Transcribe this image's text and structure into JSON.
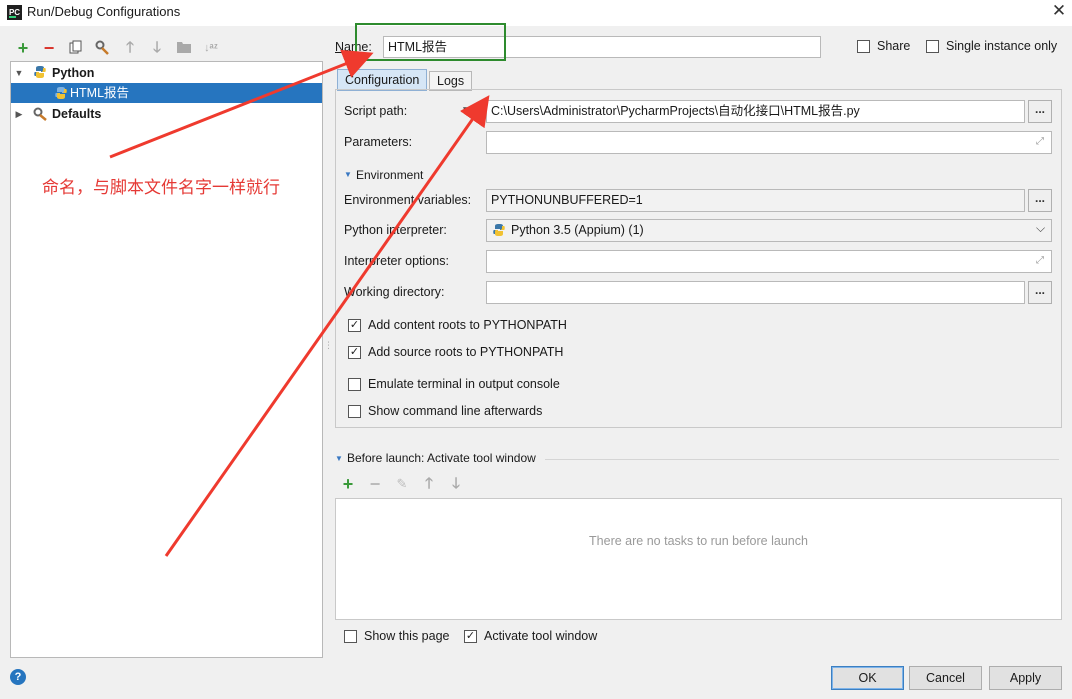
{
  "window": {
    "title": "Run/Debug Configurations",
    "app_icon": "PC"
  },
  "toolbar": {
    "icons": [
      "add-icon",
      "remove-icon",
      "copy-icon",
      "edit-defaults-icon",
      "move-up-icon",
      "move-down-icon",
      "folder-icon",
      "sort-icon"
    ]
  },
  "tree": {
    "python_label": "Python",
    "html_report_label": "HTML报告",
    "defaults_label": "Defaults"
  },
  "name_field": {
    "label": "Name:",
    "value": "HTML报告"
  },
  "options": {
    "share_label": "Share",
    "single_instance_label": "Single instance only"
  },
  "tabs": {
    "configuration": "Configuration",
    "logs": "Logs"
  },
  "config": {
    "script_path_label": "Script path:",
    "script_path_value": "C:\\Users\\Administrator\\PycharmProjects\\自动化接口\\HTML报告.py",
    "parameters_label": "Parameters:",
    "parameters_value": "",
    "environment_section": "Environment",
    "env_vars_label": "Environment variables:",
    "env_vars_value": "PYTHONUNBUFFERED=1",
    "interpreter_label": "Python interpreter:",
    "interpreter_value": "Python 3.5 (Appium) (1)",
    "interpreter_options_label": "Interpreter options:",
    "interpreter_options_value": "",
    "working_dir_label": "Working directory:",
    "working_dir_value": "",
    "browse_label": "...",
    "add_content_roots": "Add content roots to PYTHONPATH",
    "add_source_roots": "Add source roots to PYTHONPATH",
    "emulate_terminal": "Emulate terminal in output console",
    "show_command_line": "Show command line afterwards",
    "add_content_roots_checked": true,
    "add_source_roots_checked": true,
    "emulate_terminal_checked": false,
    "show_command_line_checked": false
  },
  "before_launch": {
    "title": "Before launch: Activate tool window",
    "empty_text": "There are no tasks to run before launch",
    "show_this_page": "Show this page",
    "activate_tool_window": "Activate tool window",
    "show_this_page_checked": false,
    "activate_tool_window_checked": true
  },
  "buttons": {
    "ok": "OK",
    "cancel": "Cancel",
    "apply": "Apply"
  },
  "annotation": {
    "text": "命名，与脚本文件名字一样就行",
    "color": "#e53935",
    "highlight_color": "#2e8b2e"
  },
  "colors": {
    "selection": "#2675bf",
    "add_green": "#3a9a3a",
    "remove_red": "#d9352c"
  }
}
